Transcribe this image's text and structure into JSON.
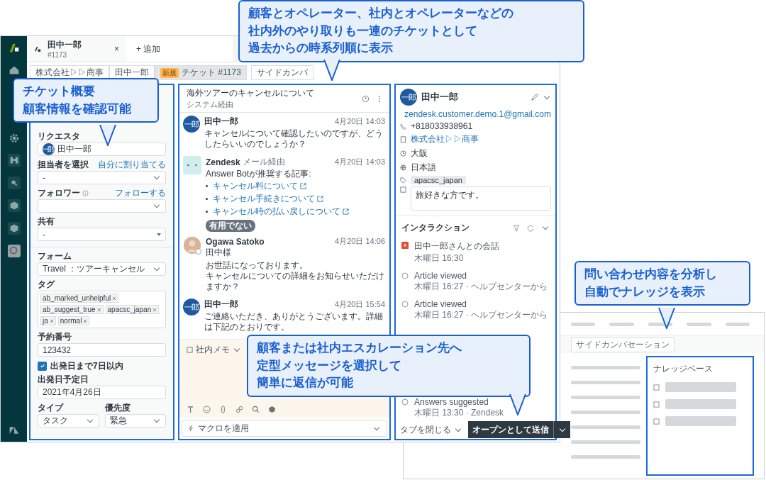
{
  "tabs": [
    {
      "title": "田中一郎",
      "subtitle": "#1173",
      "close": "×",
      "selected": true
    }
  ],
  "add_tab": "+ 追加",
  "breadcrumbs": [
    {
      "label": "株式会社▷▷商事",
      "selected": false
    },
    {
      "label": "田中一郎",
      "selected": false
    },
    {
      "badge": "新規",
      "label": "チケット #1173",
      "selected": true
    },
    {
      "label": "サイドカンバ",
      "selected": false
    }
  ],
  "ticket": {
    "requester": {
      "label": "リクエスタ",
      "avatar": "一郎",
      "value": "田中一郎"
    },
    "assignee": {
      "label": "担当者を選択",
      "link": "自分に割り当てる",
      "value": "-"
    },
    "followers": {
      "label": "フォロワー",
      "link": "フォローする"
    },
    "shared": {
      "label": "共有",
      "value": "-"
    },
    "form": {
      "label": "フォーム",
      "value": "Travel ：ツアーキャンセル"
    },
    "tags": {
      "label": "タグ",
      "items": [
        "ab_marked_unhelpful",
        "ab_suggest_true",
        "apacsc_japan",
        "ja",
        "normal"
      ]
    },
    "booking": {
      "label": "予約番号",
      "value": "123432"
    },
    "within7": {
      "label": "出発日まで7日以内",
      "checked": true
    },
    "departure": {
      "label": "出発日予定日",
      "value": "2021年4月26日"
    },
    "type": {
      "label": "タイプ",
      "value": "タスク"
    },
    "priority": {
      "label": "優先度",
      "value": "緊急"
    }
  },
  "conversation": {
    "title": "海外ツアーのキャンセルについて",
    "subtitle": "システム経由",
    "messages": [
      {
        "kind": "user",
        "avatar": "一郎",
        "author": "田中一郎",
        "time": "4月20日 14:03",
        "paragraphs": [
          [
            "キャンセルについて確認したいのですが、どうしたらいいのでしょうか？"
          ]
        ]
      },
      {
        "kind": "bot",
        "author": "Zendesk",
        "via": "メール経由",
        "time": "4月20日 14:03",
        "paragraphs": [
          [
            "Answer Botが推奨する記事:"
          ]
        ],
        "articles": [
          {
            "title": "キャンセル料について"
          },
          {
            "title": "キャンセル手続きについて"
          },
          {
            "title": "キャンセル時の払い戻しについて",
            "badge": "有用でない"
          }
        ]
      },
      {
        "kind": "agent",
        "author": "Ogawa Satoko",
        "time": "4月20日 14:06",
        "paragraphs": [
          [
            "田中様"
          ],
          [
            "お世話になっております。",
            "キャンセルについての詳細をお知らせいただけますか？"
          ]
        ]
      },
      {
        "kind": "user",
        "avatar": "一郎",
        "author": "田中一郎",
        "time": "4月20日 15:54",
        "paragraphs": [
          [
            "ご連絡いただき、ありがとうございます。詳細は下記のとおりです。"
          ]
        ]
      }
    ]
  },
  "composer": {
    "mode": "社内メモ",
    "macro": "マクロを適用"
  },
  "customer": {
    "avatar": "一郎",
    "name": "田中一郎",
    "email": "zendesk.customer.demo.1@gmail.com",
    "phone": "+818033938961",
    "organization": "株式会社▷▷商事",
    "location": "大阪",
    "language": "日本語",
    "tag": "apacsc_japan",
    "notes": "旅好きな方です。"
  },
  "interactions": {
    "title": "インタラクション",
    "items": [
      {
        "kind": "conversation",
        "title": "田中一郎さんとの会話",
        "meta": "木曜日 16:30"
      },
      {
        "kind": "event",
        "title": "Article viewed",
        "meta": "木曜日 16:27 · ヘルプセンターから"
      },
      {
        "kind": "event",
        "title": "Article viewed",
        "meta": "木曜日 16:27 · ヘルプセンターから"
      },
      {
        "kind": "event",
        "title": "Answers suggested",
        "meta": "木曜日 13:30 · Zendesk"
      }
    ]
  },
  "footer": {
    "close_tab": "タブを閉じる",
    "submit": "オープンとして送信"
  },
  "inset": {
    "tab": "サイドカンバセーション",
    "panel_title": "ナレッジベース"
  },
  "callouts": [
    {
      "lines": [
        "チケット概要",
        "顧客情報を確認可能"
      ]
    },
    {
      "lines": [
        "顧客とオペレーター、社内とオペレーターなどの",
        "社内外のやり取りも一連のチケットとして",
        "過去からの時系列順に表示"
      ]
    },
    {
      "lines": [
        "問い合わせ内容を分析し",
        "自動でナレッジを表示"
      ]
    },
    {
      "lines": [
        "顧客または社内エスカレーション先へ",
        "定型メッセージを選択して",
        "簡単に返信が可能"
      ]
    }
  ]
}
